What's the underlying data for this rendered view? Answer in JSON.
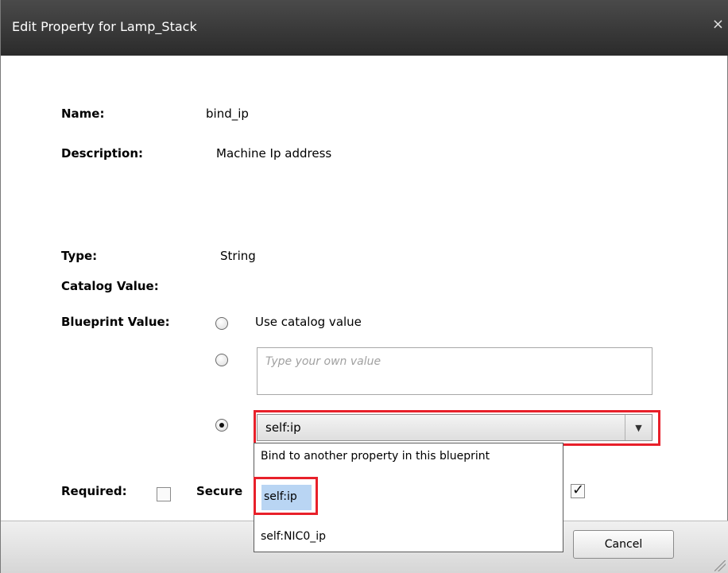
{
  "dialog": {
    "title": "Edit Property for Lamp_Stack",
    "close_symbol": "×"
  },
  "fields": {
    "name_label": "Name:",
    "name_value": "bind_ip",
    "description_label": "Description:",
    "description_value": "Machine Ip address",
    "type_label": "Type:",
    "type_value": "String",
    "catalog_value_label": "Catalog Value:",
    "blueprint_value_label": "Blueprint Value:"
  },
  "blueprint_options": {
    "use_catalog_label": "Use catalog value",
    "custom_placeholder": "Type your own value",
    "custom_value": "",
    "selected_option": "bind"
  },
  "combo": {
    "selected": "self:ip",
    "arrow_symbol": "▼"
  },
  "dropdown": {
    "header": "Bind to another property in this blueprint",
    "options": [
      "self:ip",
      "self:NIC0_ip"
    ],
    "highlighted": "self:ip"
  },
  "flags": {
    "required_label": "Required:",
    "required_checked": false,
    "secure_label_visible": "Secure",
    "overridable_checked": true
  },
  "footer": {
    "cancel_label": "Cancel"
  },
  "colors": {
    "titlebar": "#2b2b2b",
    "highlight_border": "#e8202a",
    "selection_bg": "#b9d5f3"
  }
}
